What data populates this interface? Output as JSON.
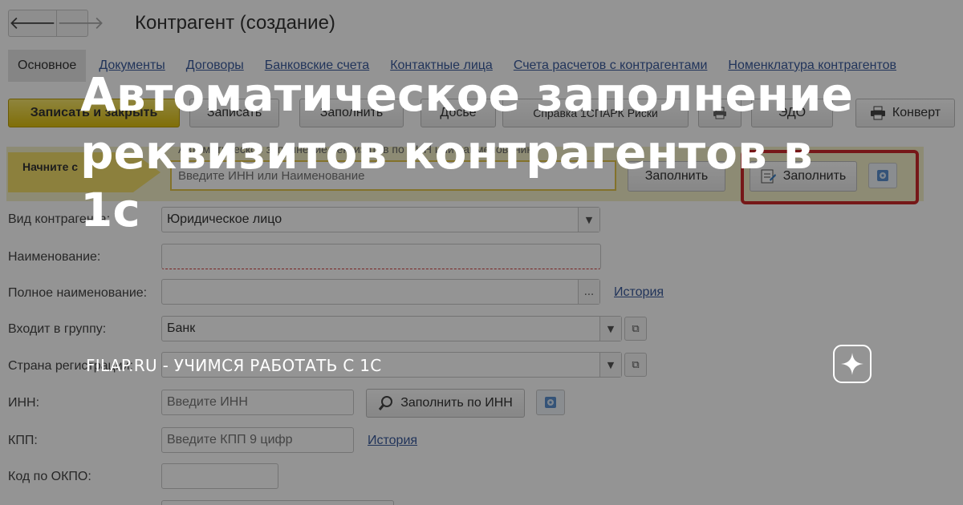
{
  "window": {
    "back_glyph": "🡐",
    "forward_glyph": "🡒",
    "title": "Контрагент (создание)"
  },
  "tabs": [
    {
      "label": "Основное",
      "active": true
    },
    {
      "label": "Документы"
    },
    {
      "label": "Договоры"
    },
    {
      "label": "Банковские счета"
    },
    {
      "label": "Контактные лица"
    },
    {
      "label": "Счета расчетов с контрагентами"
    },
    {
      "label": "Номенклатура контрагентов"
    }
  ],
  "toolbar": {
    "save_close_label": "Записать и закрыть",
    "save_label": "Записать",
    "fill_label": "Заполнить",
    "more_label": "Досье",
    "report_label": "Справка 1СПАРК Риски",
    "envelope_label": "Конверт",
    "edo_label": "ЭДО"
  },
  "autofill": {
    "start_label": "Начните с",
    "hint": "Автоматическое заполнение реквизитов по ИНН или наименованию",
    "input_placeholder": "Введите ИНН или Наименование",
    "fill_button": "Заполнить",
    "fill_button_highlighted": "Заполнить"
  },
  "form": {
    "kind_label": "Вид контрагента:",
    "kind_value": "Юридическое лицо",
    "name_label": "Наименование:",
    "name_value": "",
    "full_name_label": "Полное наименование:",
    "full_name_value": "",
    "ellipsis": "...",
    "history_link": "История",
    "group_label": "Входит в группу:",
    "group_value": "Банк",
    "country_label": "Страна регистрации:",
    "country_value": "",
    "inn_label": "ИНН:",
    "inn_placeholder": "Введите ИНН",
    "inn_fill_button": "Заполнить по ИНН",
    "kpp_label": "КПП:",
    "kpp_placeholder": "Введите КПП 9 цифр",
    "kpp_history_link": "История",
    "okpo_label": "Код по ОКПО:",
    "okpo_value": ""
  },
  "overlay": {
    "headline": "Автоматическое заполнение\nреквизитов контрагентов в 1с",
    "caption": "FILAP.RU - УЧИМСЯ РАБОТАТЬ С 1С"
  },
  "colors": {
    "link": "#3a5a9c",
    "primary_button": "#ddbf10",
    "banner": "#f3f0c9",
    "highlight_frame": "#cc2a2a"
  }
}
